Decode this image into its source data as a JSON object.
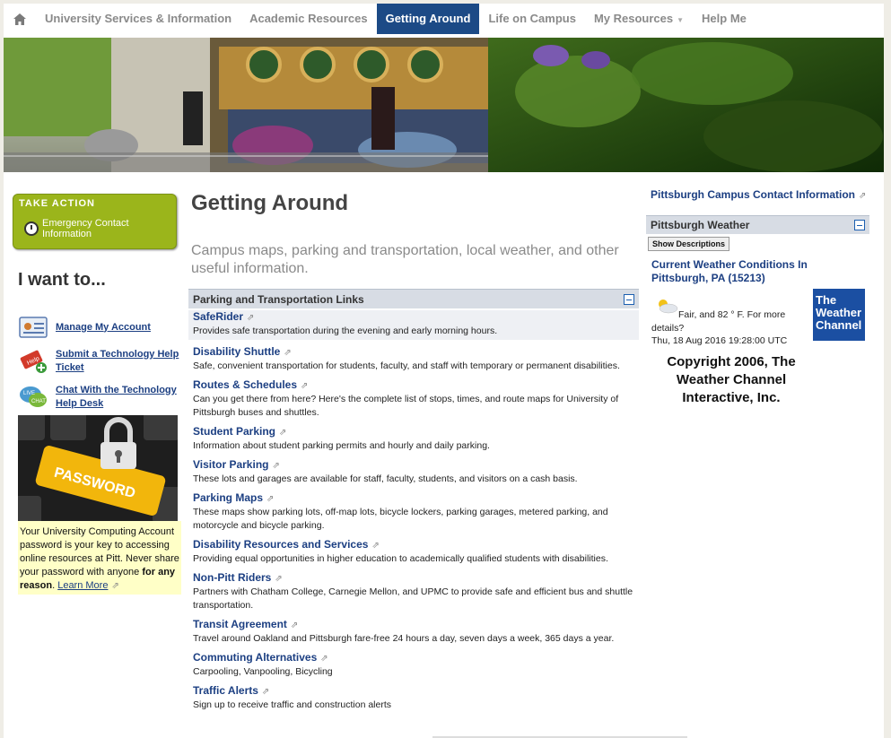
{
  "nav": {
    "items": [
      {
        "label": "University Services & Information"
      },
      {
        "label": "Academic Resources"
      },
      {
        "label": "Getting Around"
      },
      {
        "label": "Life on Campus"
      },
      {
        "label": "My Resources"
      },
      {
        "label": "Help Me"
      }
    ],
    "active_index": 2
  },
  "left": {
    "take_action_title": "TAKE ACTION",
    "take_action_link": "Emergency Contact Information",
    "i_want_to": "I want to...",
    "quick_links": [
      {
        "label": "Manage My Account",
        "icon": "account-card-icon"
      },
      {
        "label": "Submit a Technology Help Ticket",
        "icon": "help-ticket-icon"
      },
      {
        "label": "Chat With the Technology Help Desk",
        "icon": "live-chat-icon"
      }
    ],
    "password_image_text": "PASSWORD",
    "password_notice_pre": "Your University Computing Account password is your key to accessing online resources at Pitt. Never share your password with anyone ",
    "password_notice_bold": "for any reason",
    "password_notice_sep": ". ",
    "password_learn_more": "Learn More"
  },
  "main": {
    "title": "Getting Around",
    "description": "Campus maps, parking and transportation, local weather, and other useful information.",
    "panel_title": "Parking and Transportation Links",
    "links": [
      {
        "title": "SafeRider",
        "desc": "Provides safe transportation during the evening and early morning hours."
      },
      {
        "title": "Disability Shuttle",
        "desc": "Safe, convenient transportation for students, faculty, and staff with temporary or permanent disabilities."
      },
      {
        "title": "Routes & Schedules",
        "desc": "Can you get there from here? Here's the complete list of stops, times, and route maps for University of Pittsburgh buses and shuttles."
      },
      {
        "title": "Student Parking",
        "desc": "Information about student parking permits and hourly and daily parking."
      },
      {
        "title": "Visitor Parking",
        "desc": "These lots and garages are available for staff, faculty, students, and visitors on a cash basis."
      },
      {
        "title": "Parking Maps",
        "desc": "These maps show parking lots, off-map lots, bicycle lockers, parking garages, metered parking, and motorcycle and bicycle parking."
      },
      {
        "title": "Disability Resources and Services",
        "desc": "Providing equal opportunities in higher education to academically qualified students with disabilities."
      },
      {
        "title": "Non-Pitt Riders",
        "desc": "Partners with Chatham College, Carnegie Mellon, and UPMC to provide safe and efficient bus and shuttle transportation."
      },
      {
        "title": "Transit Agreement",
        "desc": "Travel around Oakland and Pittsburgh fare-free 24 hours a day, seven days a week, 365 days a year."
      },
      {
        "title": "Commuting Alternatives",
        "desc": "Carpooling, Vanpooling, Bicycling"
      },
      {
        "title": "Traffic Alerts",
        "desc": "Sign up to receive traffic and construction alerts"
      }
    ]
  },
  "right": {
    "contact_link": "Pittsburgh Campus Contact Information",
    "weather_title": "Pittsburgh Weather",
    "show_descriptions": "Show Descriptions",
    "current_conditions": "Current Weather Conditions In Pittsburgh, PA (15213)",
    "conditions_text": "Fair, and 82 ° F. For more details?",
    "timestamp": "Thu, 18 Aug 2016 19:28:00 UTC",
    "copyright": "Copyright 2006, The Weather Channel Interactive, Inc.",
    "logo_text": "The Weather Channel"
  },
  "colors": {
    "nav_active": "#1c4a86",
    "link": "#1c3f82",
    "take_action": "#9bb51b",
    "notice_bg": "#ffffc7",
    "weather_logo": "#1b4fa2"
  }
}
